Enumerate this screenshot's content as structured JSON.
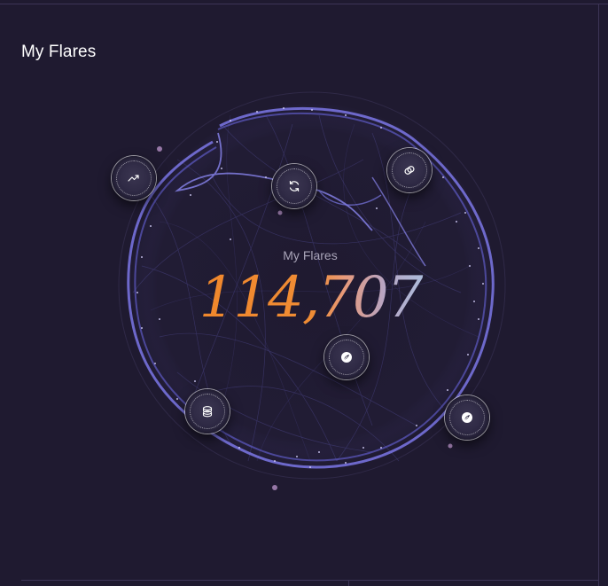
{
  "page": {
    "title": "My Flares"
  },
  "globe": {
    "label": "My Flares",
    "value": "114,707",
    "accent_color": "#6f6bd6",
    "value_gradient": [
      "#f0862a",
      "#ef8c35",
      "#e79a7c",
      "#b7a5c4",
      "#a7c8e6"
    ]
  },
  "orbs": [
    {
      "icon": "trending-up-icon"
    },
    {
      "icon": "refresh-icon"
    },
    {
      "icon": "link-icon"
    },
    {
      "icon": "leaf-icon"
    },
    {
      "icon": "coins-stack-icon"
    },
    {
      "icon": "leaf-icon"
    }
  ]
}
